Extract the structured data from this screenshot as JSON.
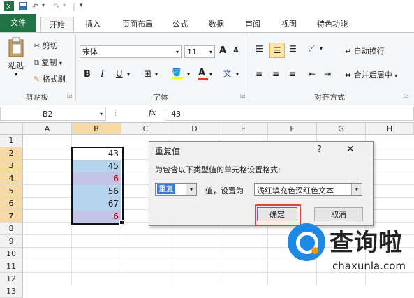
{
  "title_bar": {
    "separator": "|",
    "undo_arrow": "▾",
    "redo_arrow": "▾"
  },
  "tabs": [
    "文件",
    "开始",
    "插入",
    "页面布局",
    "公式",
    "数据",
    "审阅",
    "视图",
    "特色功能"
  ],
  "clipboard": {
    "paste": "粘贴",
    "cut": "剪切",
    "copy": "复制",
    "format_painter": "格式刷",
    "label": "剪贴板"
  },
  "font": {
    "name": "宋体",
    "size": "11",
    "bold": "B",
    "italic": "I",
    "underline": "U",
    "grow": "A",
    "shrink": "A",
    "phonetic_label": "文",
    "label": "字体"
  },
  "alignment": {
    "wrap_text": "自动换行",
    "merge_center": "合并后居中",
    "label": "对齐方式"
  },
  "formula_bar": {
    "name_box": "B2",
    "fx": "fx",
    "value": "43"
  },
  "columns": [
    "A",
    "B",
    "C",
    "D",
    "E",
    "F",
    "G",
    "H"
  ],
  "rows": [
    "1",
    "2",
    "3",
    "4",
    "5",
    "6",
    "7",
    "8",
    "9",
    "10",
    "11",
    "12",
    "13"
  ],
  "cells_b": [
    "43",
    "45",
    "6",
    "56",
    "67",
    "6"
  ],
  "cell_colors": {
    "dup_fill": "#c3c4e6",
    "dup_text": "#9c0006",
    "normal_fill": "#b7d4ee",
    "header_highlight": "#f7d9a6",
    "accent": "#217346"
  },
  "dialog": {
    "title": "重复值",
    "help": "?",
    "close": "✕",
    "prompt": "为包含以下类型值的单元格设置格式:",
    "type_value": "重复",
    "middle_label": "值，设置为",
    "format_value": "浅红填充色深红色文本",
    "ok": "确定",
    "cancel": "取消"
  },
  "watermark": {
    "name": "查询啦",
    "url": "chaxunla.com"
  }
}
